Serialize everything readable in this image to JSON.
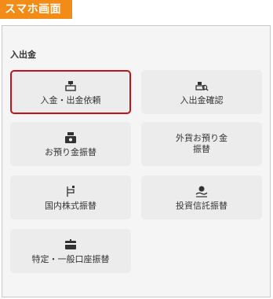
{
  "header": {
    "tag": "スマホ画面"
  },
  "section": {
    "title": "入出金"
  },
  "tiles": [
    {
      "label": "入金・出金依頼",
      "icon": "deposit-withdraw-icon",
      "selected": true
    },
    {
      "label": "入出金確認",
      "icon": "deposit-check-icon",
      "selected": false
    },
    {
      "label": "お預り金振替",
      "icon": "cash-transfer-icon",
      "selected": false
    },
    {
      "label": "外貨お預り金\n振替",
      "icon": "",
      "selected": false
    },
    {
      "label": "国内株式振替",
      "icon": "stock-transfer-icon",
      "selected": false
    },
    {
      "label": "投資信託振替",
      "icon": "fund-transfer-icon",
      "selected": false
    },
    {
      "label": "特定・一般口座振替",
      "icon": "account-transfer-icon",
      "selected": false
    }
  ],
  "colors": {
    "accent": "#f28c16",
    "selected_border": "#c0141c",
    "icon": "#333333"
  }
}
